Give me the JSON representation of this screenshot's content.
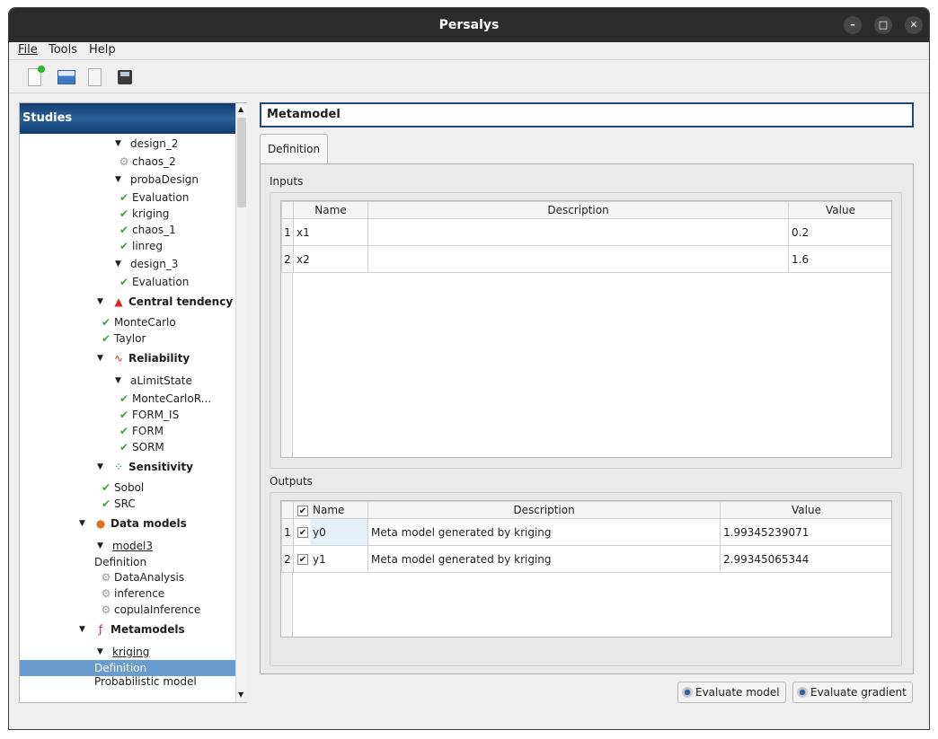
{
  "window": {
    "title": "Persalys",
    "controls": [
      "–",
      "□",
      "✕"
    ]
  },
  "menu": [
    "File",
    "Tools",
    "Help"
  ],
  "toolbar": [
    "new-study-icon",
    "open-study-icon",
    "import-icon",
    "save-icon"
  ],
  "tree": {
    "header": "Studies",
    "items": [
      {
        "label": "design_2",
        "arrow": true,
        "indent": 1,
        "icon": null
      },
      {
        "label": "chaos_2",
        "indent": 2,
        "icon": "gear"
      },
      {
        "label": "probaDesign",
        "arrow": true,
        "indent": 1,
        "icon": null
      },
      {
        "label": "Evaluation",
        "indent": 2,
        "icon": "check"
      },
      {
        "label": "kriging",
        "indent": 2,
        "icon": "check"
      },
      {
        "label": "chaos_1",
        "indent": 2,
        "icon": "check"
      },
      {
        "label": "linreg",
        "indent": 2,
        "icon": "check"
      },
      {
        "label": "design_3",
        "arrow": true,
        "indent": 1,
        "icon": null
      },
      {
        "label": "Evaluation",
        "indent": 2,
        "icon": "check"
      },
      {
        "label": "Central tendency",
        "arrow": true,
        "indent": 0,
        "icon": "histogram",
        "bold": true
      },
      {
        "label": "MonteCarlo",
        "indent": 1,
        "icon": "check"
      },
      {
        "label": "Taylor",
        "indent": 1,
        "icon": "check"
      },
      {
        "label": "Reliability",
        "arrow": true,
        "indent": 0,
        "icon": "curve",
        "bold": true
      },
      {
        "label": "aLimitState",
        "arrow": true,
        "indent": 1,
        "icon": null
      },
      {
        "label": "MonteCarloR...",
        "indent": 2,
        "icon": "check"
      },
      {
        "label": "FORM_IS",
        "indent": 2,
        "icon": "check"
      },
      {
        "label": "FORM",
        "indent": 2,
        "icon": "check"
      },
      {
        "label": "SORM",
        "indent": 2,
        "icon": "check"
      },
      {
        "label": "Sensitivity",
        "arrow": true,
        "indent": 0,
        "icon": "scatter",
        "bold": true
      },
      {
        "label": "Sobol",
        "indent": 1,
        "icon": "check"
      },
      {
        "label": "SRC",
        "indent": 1,
        "icon": "check"
      },
      {
        "label": "Data models",
        "arrow": true,
        "indent": -1,
        "icon": "pie",
        "bold": true
      },
      {
        "label": "model3",
        "arrow": true,
        "indent": 0,
        "icon": null,
        "underline": true
      },
      {
        "label": "Definition",
        "indent": 0.5,
        "icon": null
      },
      {
        "label": "DataAnalysis",
        "indent": 1,
        "icon": "gear"
      },
      {
        "label": "inference",
        "indent": 1,
        "icon": "gear"
      },
      {
        "label": "copulaInference",
        "indent": 1,
        "icon": "gear"
      },
      {
        "label": "Metamodels",
        "arrow": true,
        "indent": -1,
        "icon": "function",
        "bold": true
      },
      {
        "label": "kriging",
        "arrow": true,
        "indent": 0,
        "icon": null,
        "underline": true
      },
      {
        "label": "Definition",
        "indent": 0.5,
        "icon": null,
        "selected": true
      },
      {
        "label": "Probabilistic model",
        "indent": 0.5,
        "icon": null
      }
    ]
  },
  "main": {
    "title": "Metamodel",
    "tab": "Definition",
    "inputs": {
      "label": "Inputs",
      "columns": [
        "Name",
        "Description",
        "Value"
      ],
      "rows": [
        {
          "n": "1",
          "name": "x1",
          "desc": "",
          "value": "0.2"
        },
        {
          "n": "2",
          "name": "x2",
          "desc": "",
          "value": "1.6"
        }
      ]
    },
    "outputs": {
      "label": "Outputs",
      "columns": [
        "Name",
        "Description",
        "Value"
      ],
      "rows": [
        {
          "n": "1",
          "name": "y0",
          "desc": "Meta model generated by kriging",
          "value": "1.99345239071",
          "checked": true
        },
        {
          "n": "2",
          "name": "y1",
          "desc": "Meta model generated by kriging",
          "value": "2.99345065344",
          "checked": true
        }
      ]
    },
    "buttons": {
      "evaluate_model": "Evaluate model",
      "evaluate_gradient": "Evaluate gradient"
    }
  },
  "colors": {
    "selection": "#6a9bd1",
    "header": "#1d4f86",
    "check": "#3fa33f"
  }
}
